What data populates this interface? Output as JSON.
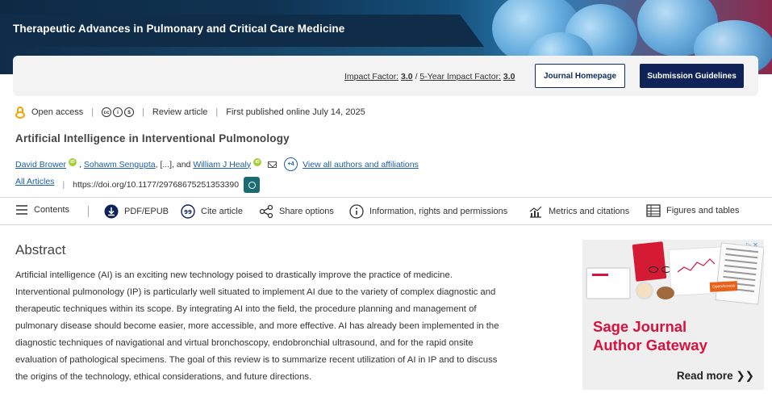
{
  "journal": {
    "title": "Therapeutic Advances in Pulmonary and Critical Care Medicine",
    "impact_factor_label": "Impact Factor:",
    "impact_factor_value": "3.0",
    "five_year_label": "5-Year Impact Factor:",
    "five_year_value": "3.0",
    "homepage_button": "Journal Homepage",
    "submission_button": "Submission Guidelines"
  },
  "meta": {
    "access": "Open access",
    "type": "Review article",
    "published": "First published online July 14, 2025"
  },
  "article": {
    "title": "Artificial Intelligence in Interventional Pulmonology",
    "authors": [
      "David Brower",
      "Sohawm Sengupta",
      "William J Healy"
    ],
    "ellipsis": ", [...], and",
    "more_count": "+4",
    "view_all": "View all authors and affiliations",
    "all_articles": "All Articles",
    "doi": "https://doi.org/10.1177/29768675251353390"
  },
  "toolbar": {
    "contents": "Contents",
    "pdf": "PDF/EPUB",
    "cite": "Cite article",
    "share": "Share options",
    "info": "Information, rights and permissions",
    "metrics": "Metrics and citations",
    "figures": "Figures and tables"
  },
  "abstract": {
    "heading": "Abstract",
    "text": "Artificial intelligence (AI) is an exciting new technology poised to drastically improve the practice of medicine. Interventional pulmonology (IP) is particularly well situated to implement AI due to the variety of complex diagnostic and therapeutic techniques within its scope. By integrating AI into the field, the procedure planning and management of pulmonary disease should become easier, more accessible, and more effective. AI has already been implemented in the diagnostic techniques of navigational and virtual bronchoscopy, endobronchial ultrasound, and for the rapid onsite evaluation of pathological specimens. The goal of this review is to summarize recent utilization of AI in IP and to discuss the origins of the technology, ethical considerations, and future directions."
  },
  "ad": {
    "line1": "Sage Journal",
    "line2": "Author Gateway",
    "read_more": "Read more",
    "open_access_tag": "OpenAccess"
  },
  "colors": {
    "navy": "#0f2358",
    "link": "#1b5fa8",
    "ad_red": "#d6123f",
    "orcid": "#a6ce39",
    "open_access": "#f0a500"
  }
}
